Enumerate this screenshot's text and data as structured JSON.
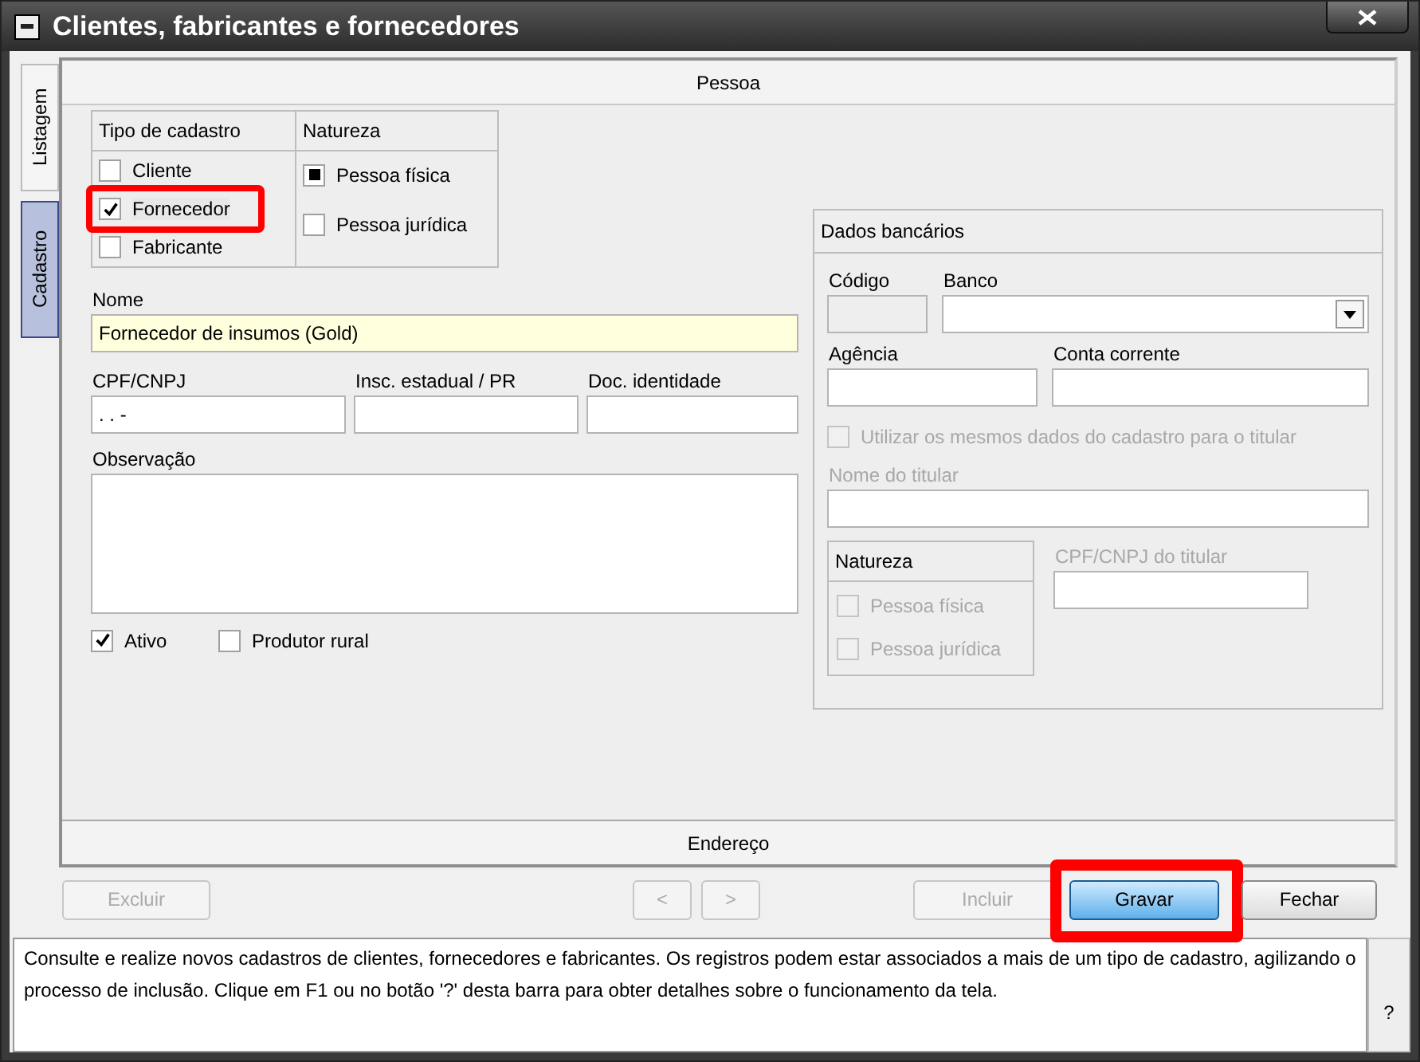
{
  "window": {
    "title": "Clientes, fabricantes e fornecedores"
  },
  "side_tabs": [
    {
      "label": "Listagem",
      "selected": false
    },
    {
      "label": "Cadastro",
      "selected": true
    }
  ],
  "sections": [
    {
      "title": "Pessoa"
    },
    {
      "title": "Endereço"
    }
  ],
  "tipo_cadastro": {
    "title": "Tipo de cadastro",
    "options": [
      {
        "label": "Cliente",
        "checked": false,
        "highlighted": false
      },
      {
        "label": "Fornecedor",
        "checked": true,
        "highlighted": true
      },
      {
        "label": "Fabricante",
        "checked": false,
        "highlighted": false
      }
    ]
  },
  "natureza": {
    "title": "Natureza",
    "options": [
      {
        "label": "Pessoa física",
        "selected": true
      },
      {
        "label": "Pessoa jurídica",
        "selected": false
      }
    ]
  },
  "nome": {
    "label": "Nome",
    "value": "Fornecedor de insumos (Gold)"
  },
  "documents": [
    {
      "label": "CPF/CNPJ",
      "value": ".  .  -"
    },
    {
      "label": "Insc. estadual / PR"
    },
    {
      "label": "Doc. identidade"
    }
  ],
  "observacao": {
    "label": "Observação"
  },
  "flags": [
    {
      "label": "Ativo",
      "checked": true
    },
    {
      "label": "Produtor rural",
      "checked": false
    }
  ],
  "bank": {
    "title": "Dados bancários",
    "codigo": {
      "label": "Código"
    },
    "banco": {
      "label": "Banco"
    },
    "agencia": {
      "label": "Agência"
    },
    "conta": {
      "label": "Conta corrente"
    },
    "same_data": {
      "label": "Utilizar os mesmos dados do cadastro para o titular",
      "checked": false,
      "disabled": true
    },
    "nome_titular": {
      "label": "Nome do titular",
      "disabled": true
    },
    "natureza": {
      "title": "Natureza",
      "options": [
        {
          "label": "Pessoa física",
          "selected": false,
          "disabled": true
        },
        {
          "label": "Pessoa jurídica",
          "selected": false,
          "disabled": true
        }
      ]
    },
    "cpf_titular": {
      "label": "CPF/CNPJ do titular",
      "disabled": true
    }
  },
  "buttons": [
    {
      "label": "Excluir",
      "disabled": true,
      "highlighted": false
    },
    {
      "label": "<",
      "disabled": true,
      "highlighted": false
    },
    {
      "label": ">",
      "disabled": true,
      "highlighted": false
    },
    {
      "label": "Incluir",
      "disabled": true,
      "highlighted": false
    },
    {
      "label": "Gravar",
      "disabled": false,
      "highlighted": true
    },
    {
      "label": "Fechar",
      "disabled": false,
      "highlighted": false
    }
  ],
  "help": {
    "text": "Consulte e realize novos cadastros de clientes, fornecedores e fabricantes. Os registros podem estar associados a mais de um tipo de cadastro, agilizando o processo de inclusão. Clique em F1 ou no botão '?' desta barra para obter detalhes sobre o funcionamento da tela.",
    "button": "?"
  }
}
